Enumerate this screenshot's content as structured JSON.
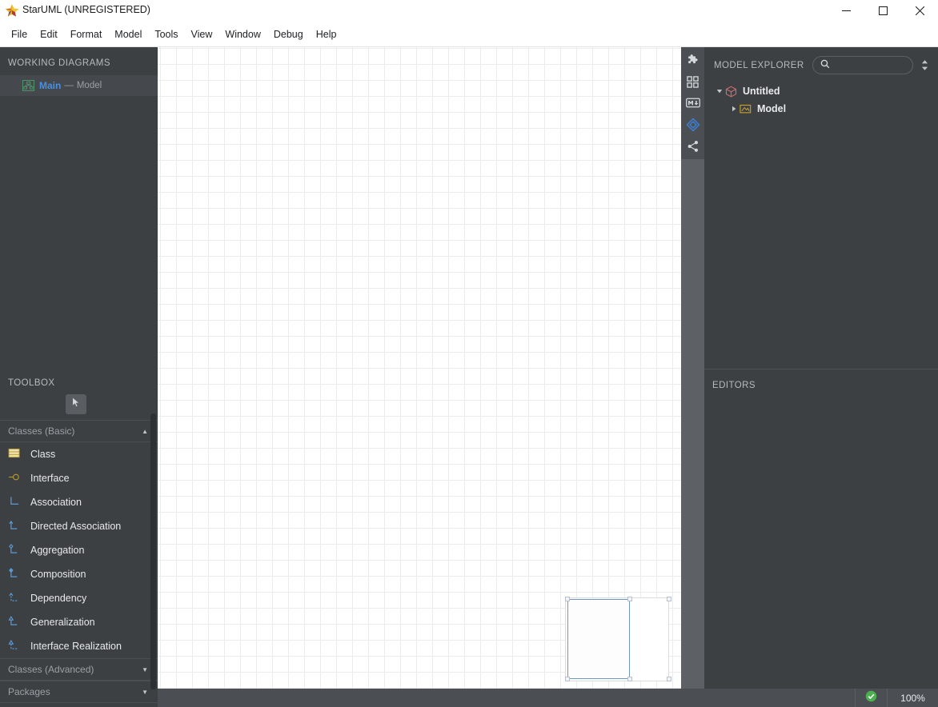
{
  "window": {
    "title": "StarUML (UNREGISTERED)",
    "logo_icon": "staruml-star-icon",
    "controls": [
      {
        "name": "minimize",
        "icon": "minimize-icon"
      },
      {
        "name": "maximize",
        "icon": "maximize-icon"
      },
      {
        "name": "close",
        "icon": "close-icon"
      }
    ]
  },
  "menubar": {
    "items": [
      {
        "label": "File"
      },
      {
        "label": "Edit"
      },
      {
        "label": "Format"
      },
      {
        "label": "Model"
      },
      {
        "label": "Tools"
      },
      {
        "label": "View"
      },
      {
        "label": "Window"
      },
      {
        "label": "Debug"
      },
      {
        "label": "Help"
      }
    ]
  },
  "working_diagrams": {
    "header": "WORKING DIAGRAMS",
    "items": [
      {
        "name": "Main",
        "separator": "—",
        "owner": "Model",
        "icon": "class-diagram-icon",
        "selected": true
      }
    ]
  },
  "toolbox": {
    "header": "TOOLBOX",
    "select_tool": {
      "name": "select-tool",
      "icon": "cursor-arrow-icon",
      "active": true
    },
    "groups": [
      {
        "label": "Classes (Basic)",
        "expanded": true,
        "caret": "▲",
        "items": [
          {
            "label": "Class",
            "icon": "class-icon"
          },
          {
            "label": "Interface",
            "icon": "interface-icon"
          },
          {
            "label": "Association",
            "icon": "association-icon"
          },
          {
            "label": "Directed Association",
            "icon": "directed-association-icon"
          },
          {
            "label": "Aggregation",
            "icon": "aggregation-icon"
          },
          {
            "label": "Composition",
            "icon": "composition-icon"
          },
          {
            "label": "Dependency",
            "icon": "dependency-icon"
          },
          {
            "label": "Generalization",
            "icon": "generalization-icon"
          },
          {
            "label": "Interface Realization",
            "icon": "interface-realization-icon"
          }
        ]
      },
      {
        "label": "Classes (Advanced)",
        "expanded": false,
        "caret": "▼",
        "items": []
      },
      {
        "label": "Packages",
        "expanded": false,
        "caret": "▼",
        "items": []
      }
    ]
  },
  "canvas": {
    "grid": true,
    "grid_size": 20,
    "shapes": [
      {
        "name": "background-rect",
        "selected": false
      },
      {
        "name": "selected-rect",
        "selected": true
      }
    ]
  },
  "vertical_toolbar": {
    "buttons": [
      {
        "name": "extension-manager",
        "icon": "puzzle-icon",
        "active": false
      },
      {
        "name": "grid-view",
        "icon": "grid-squares-icon",
        "active": false
      },
      {
        "name": "markdown-editor",
        "icon": "markdown-icon",
        "active": false
      },
      {
        "name": "diagram-navigate",
        "icon": "diamond-target-icon",
        "active": true
      },
      {
        "name": "relationship-share",
        "icon": "share-nodes-icon",
        "active": false
      }
    ]
  },
  "model_explorer": {
    "header": "MODEL EXPLORER",
    "search": {
      "placeholder": "",
      "value": "",
      "icon": "search-icon"
    },
    "sorter_icon": "sort-updown-icon",
    "tree": [
      {
        "label": "Untitled",
        "icon": "project-box-icon",
        "level": 1,
        "expanded": true,
        "twisty": "▾"
      },
      {
        "label": "Model",
        "icon": "model-folder-icon",
        "level": 2,
        "expanded": false,
        "twisty": "▸"
      }
    ]
  },
  "editors": {
    "header": "EDITORS"
  },
  "statusbar": {
    "validation_icon": "green-check-icon",
    "zoom": "100%"
  },
  "colors": {
    "panel_bg": "#3c4043",
    "titlebar_bg": "#ffffff",
    "accent_blue": "#4a90e2",
    "tool_yellow": "#c9a227",
    "tool_blue": "#5b9bd5",
    "status_green": "#4caf50",
    "selection_blue": "#6f96c4"
  }
}
